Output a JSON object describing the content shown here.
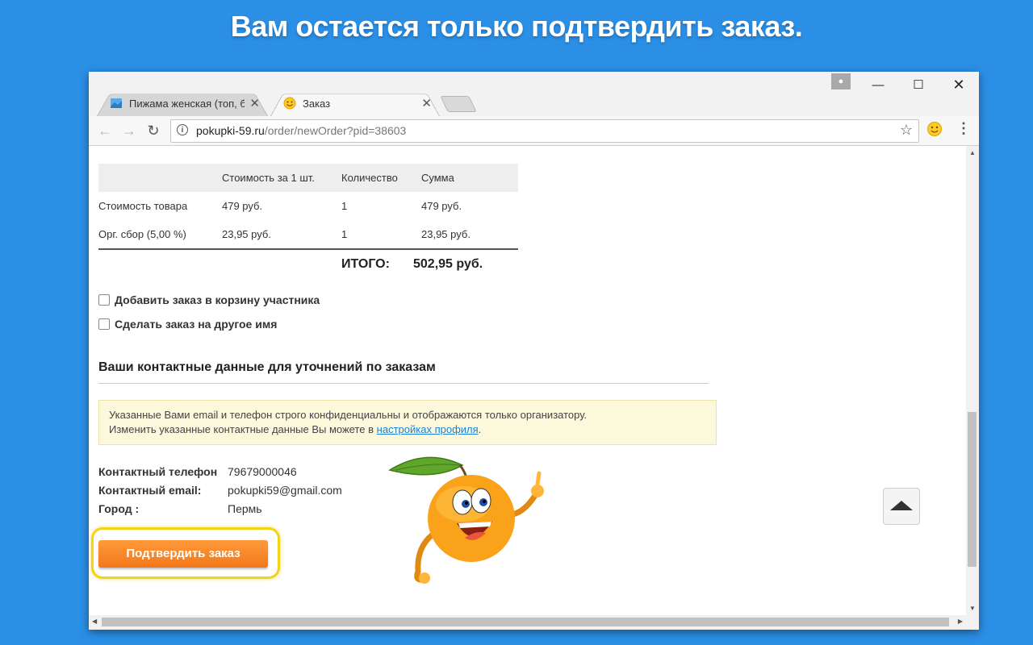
{
  "headline": "Вам остается только подтвердить заказ.",
  "browser": {
    "tabs": [
      {
        "label": "Пижама женская (топ, б",
        "active": false
      },
      {
        "label": "Заказ",
        "active": true
      }
    ],
    "url_host": "pokupki-59.ru",
    "url_path": "/order/newOrder?pid=38603"
  },
  "order_table": {
    "headers": [
      "",
      "Стоимость за 1 шт.",
      "Количество",
      "Сумма"
    ],
    "rows": [
      [
        "Стоимость товара",
        "479 руб.",
        "1",
        "479 руб."
      ],
      [
        "Орг. сбор (5,00 %)",
        "23,95 руб.",
        "1",
        "23,95 руб."
      ]
    ],
    "total_label": "ИТОГО:",
    "total_value": "502,95 руб."
  },
  "options": {
    "add_to_cart": "Добавить заказ в корзину участника",
    "other_name": "Сделать заказ на другое имя"
  },
  "contacts": {
    "section_title": "Ваши контактные данные для уточнений по заказам",
    "notice_line1": "Указанные Вами email и телефон строго конфиденциальны и отображаются только организатору.",
    "notice_line2_prefix": "Изменить указанные контактные данные Вы можете в",
    "notice_link": "настройках профиля",
    "notice_line2_suffix": ".",
    "phone_label": "Контактный телефон",
    "phone_value": "79679000046",
    "email_label": "Контактный email:",
    "email_value": "pokupki59@gmail.com",
    "city_label": "Город :",
    "city_value": "Пермь"
  },
  "confirm_label": "Подтвердить заказ",
  "colors": {
    "background": "#2b8fe6",
    "confirm": "#f2781a",
    "highlight": "#f3d21a"
  }
}
